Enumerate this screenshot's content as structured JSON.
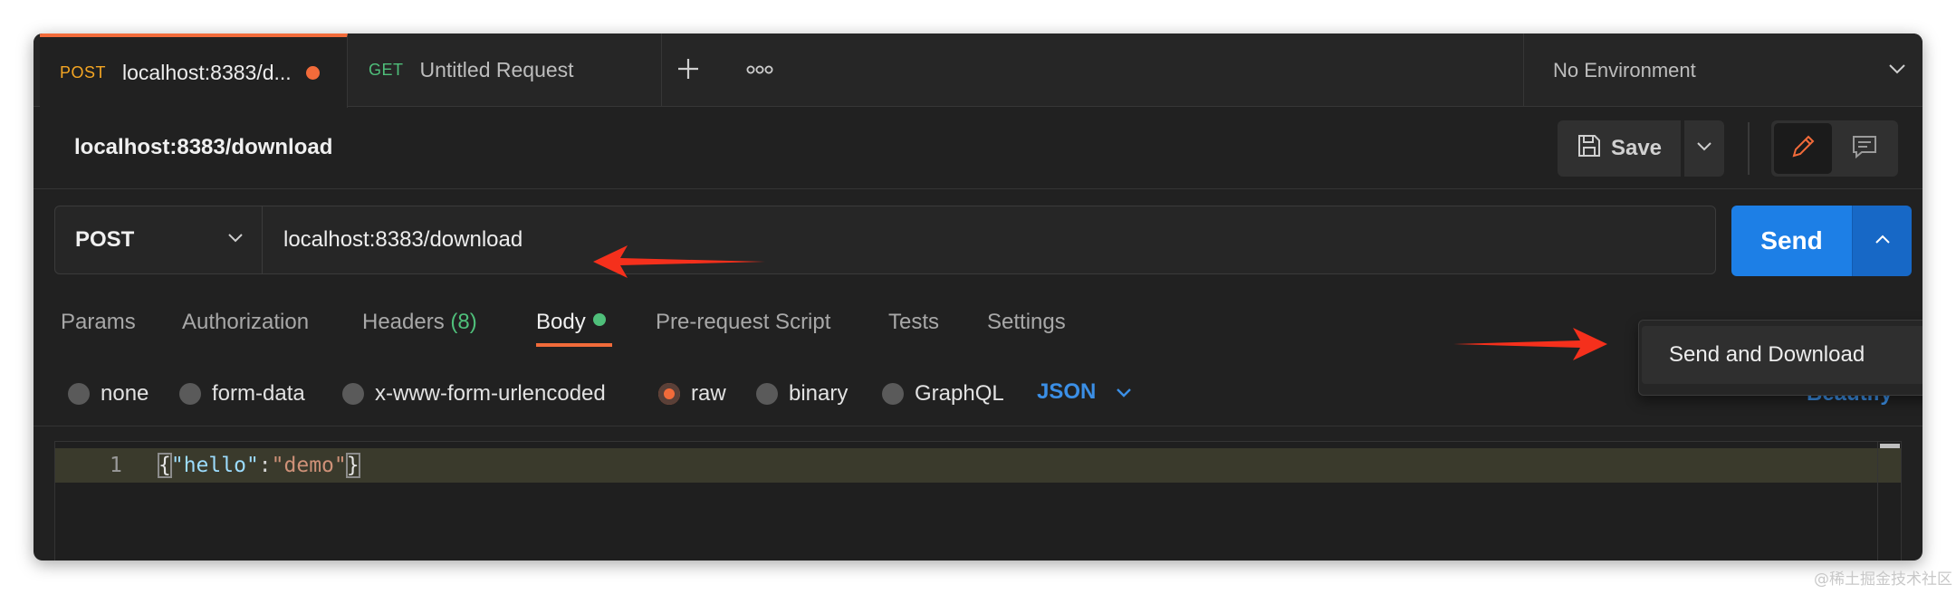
{
  "tabs": [
    {
      "method": "POST",
      "title": "localhost:8383/d...",
      "unsaved": true
    },
    {
      "method": "GET",
      "title": "Untitled Request"
    }
  ],
  "environment": {
    "label": "No Environment"
  },
  "request": {
    "title": "localhost:8383/download",
    "method": "POST",
    "url": "localhost:8383/download"
  },
  "toolbar": {
    "save_label": "Save"
  },
  "send": {
    "label": "Send"
  },
  "send_menu": {
    "items": [
      "Send and Download"
    ]
  },
  "request_tabs": {
    "params": "Params",
    "authorization": "Authorization",
    "headers": "Headers",
    "headers_count": "(8)",
    "body": "Body",
    "prerequest": "Pre-request Script",
    "tests": "Tests",
    "settings": "Settings",
    "active": "Body"
  },
  "body_types": {
    "options": [
      "none",
      "form-data",
      "x-www-form-urlencoded",
      "raw",
      "binary",
      "GraphQL"
    ],
    "selected": "raw",
    "language": "JSON",
    "beautify": "Beautify"
  },
  "editor": {
    "line_number": "1",
    "brace_open": "{",
    "key": "\"hello\"",
    "colon": ":",
    "value": "\"demo\"",
    "brace_close": "}"
  },
  "watermark": "@稀土掘金技术社区",
  "colors": {
    "accent": "#f26b3a",
    "send_blue": "#1d7fe6",
    "link_blue": "#3b8fe6",
    "get_green": "#4fbf7a",
    "post_orange": "#f5a623"
  }
}
